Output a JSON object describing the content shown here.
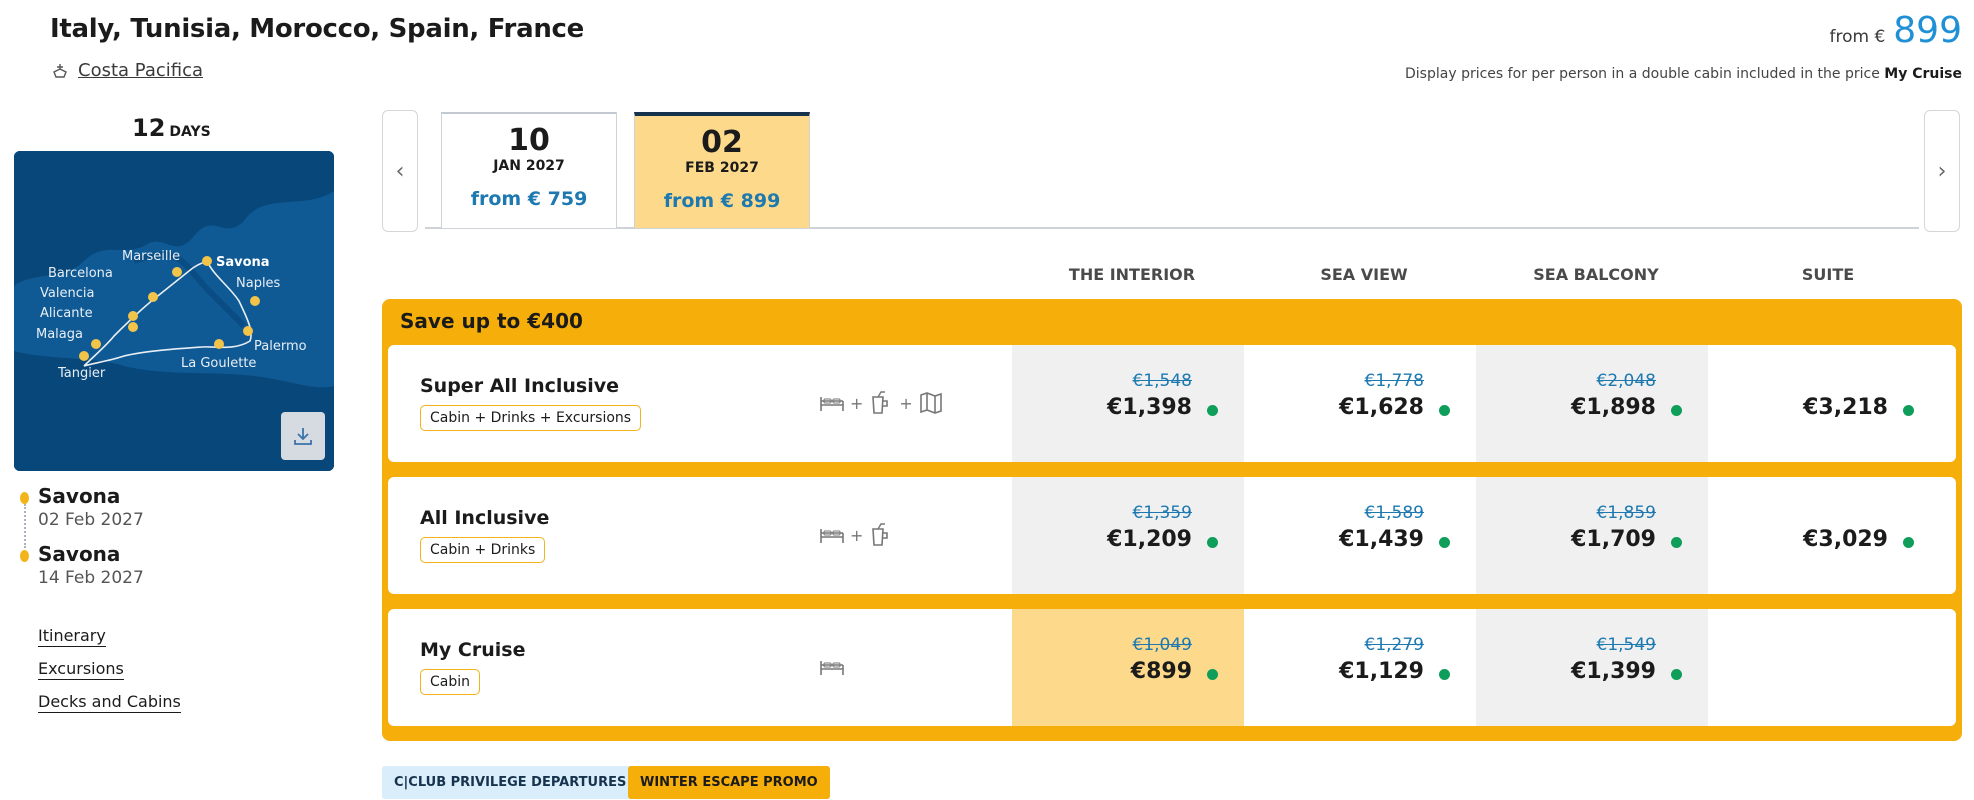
{
  "header": {
    "title": "Italy, Tunisia, Morocco, Spain, France",
    "ship": "Costa Pacifica",
    "from_label": "from €",
    "from_amount": "899",
    "note_prefix": "Display prices for per person in a double cabin included in the price",
    "note_bold": "My Cruise"
  },
  "left": {
    "days_num": "12",
    "days_label": "DAYS",
    "map_ports": [
      "Marseille",
      "Savona",
      "Barcelona",
      "Naples",
      "Valencia",
      "Alicante",
      "Malaga",
      "Palermo",
      "La Goulette",
      "Tangier"
    ],
    "route": [
      {
        "port": "Savona",
        "date": "02 Feb 2027"
      },
      {
        "port": "Savona",
        "date": "14 Feb 2027"
      }
    ],
    "links": [
      "Itinerary",
      "Excursions",
      "Decks and Cabins"
    ]
  },
  "tabs": [
    {
      "day": "10",
      "month": "JAN 2027",
      "price": "from € 759"
    },
    {
      "day": "02",
      "month": "FEB 2027",
      "price": "from € 899"
    }
  ],
  "nav": {
    "prev": "‹",
    "next": "›"
  },
  "cabins": [
    "THE INTERIOR",
    "SEA VIEW",
    "SEA BALCONY",
    "SUITE"
  ],
  "offers": {
    "save": "Save up to €400",
    "rows": [
      {
        "name": "Super All Inclusive",
        "badge": "Cabin + Drinks + Excursions",
        "icons": [
          "bed-icon",
          "drink-icon",
          "map-icon"
        ],
        "prices": [
          {
            "old": "€1,548",
            "new": "€1,398"
          },
          {
            "old": "€1,778",
            "new": "€1,628"
          },
          {
            "old": "€2,048",
            "new": "€1,898"
          },
          {
            "old": "",
            "new": "€3,218"
          }
        ]
      },
      {
        "name": "All Inclusive",
        "badge": "Cabin + Drinks",
        "icons": [
          "bed-icon",
          "drink-icon"
        ],
        "prices": [
          {
            "old": "€1,359",
            "new": "€1,209"
          },
          {
            "old": "€1,589",
            "new": "€1,439"
          },
          {
            "old": "€1,859",
            "new": "€1,709"
          },
          {
            "old": "",
            "new": "€3,029"
          }
        ]
      },
      {
        "name": "My Cruise",
        "badge": "Cabin",
        "icons": [
          "bed-icon"
        ],
        "prices": [
          {
            "old": "€1,049",
            "new": "€899"
          },
          {
            "old": "€1,279",
            "new": "€1,129"
          },
          {
            "old": "€1,549",
            "new": "€1,399"
          },
          {
            "old": "",
            "new": ""
          }
        ]
      }
    ]
  },
  "promos": [
    "C|CLUB PRIVILEGE DEPARTURES",
    "WINTER ESCAPE PROMO"
  ],
  "colors": {
    "accent": "#f5ae0a",
    "price_blue": "#1f8fd6",
    "available": "#0f9d5a"
  }
}
